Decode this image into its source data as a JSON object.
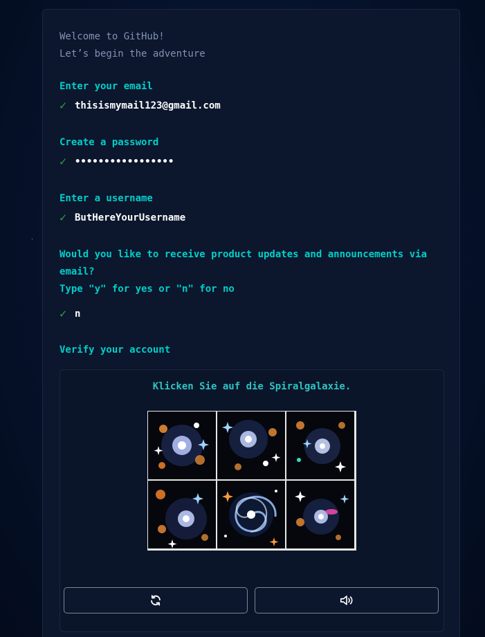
{
  "welcome": {
    "line1": "Welcome to GitHub!",
    "line2": "Let’s begin the adventure"
  },
  "email": {
    "prompt": "Enter your email",
    "value": "thisismymail123@gmail.com"
  },
  "password": {
    "prompt": "Create a password",
    "value": "•••••••••••••••••"
  },
  "username": {
    "prompt": "Enter a username",
    "value": "ButHereYourUsername"
  },
  "updates": {
    "prompt_line1": "Would you like to receive product updates and announcements via",
    "prompt_line2": "email?",
    "prompt_line3": "Type \"y\" for yes or \"n\" for no",
    "value": "n"
  },
  "verify": {
    "prompt": "Verify your account",
    "instruction": "Klicken Sie auf die Spiralgalaxie.",
    "tiles": [
      {
        "icon": "star-cluster-image"
      },
      {
        "icon": "star-cluster-image"
      },
      {
        "icon": "star-cluster-image"
      },
      {
        "icon": "star-cluster-image"
      },
      {
        "icon": "spiral-galaxy-image"
      },
      {
        "icon": "star-cluster-image"
      }
    ],
    "buttons": [
      {
        "icon": "reload-icon"
      },
      {
        "icon": "audio-icon"
      }
    ]
  },
  "colors": {
    "prompt": "#00cfc8",
    "check": "#2ea043",
    "muted": "#8193b2",
    "background": "#0c162d"
  }
}
